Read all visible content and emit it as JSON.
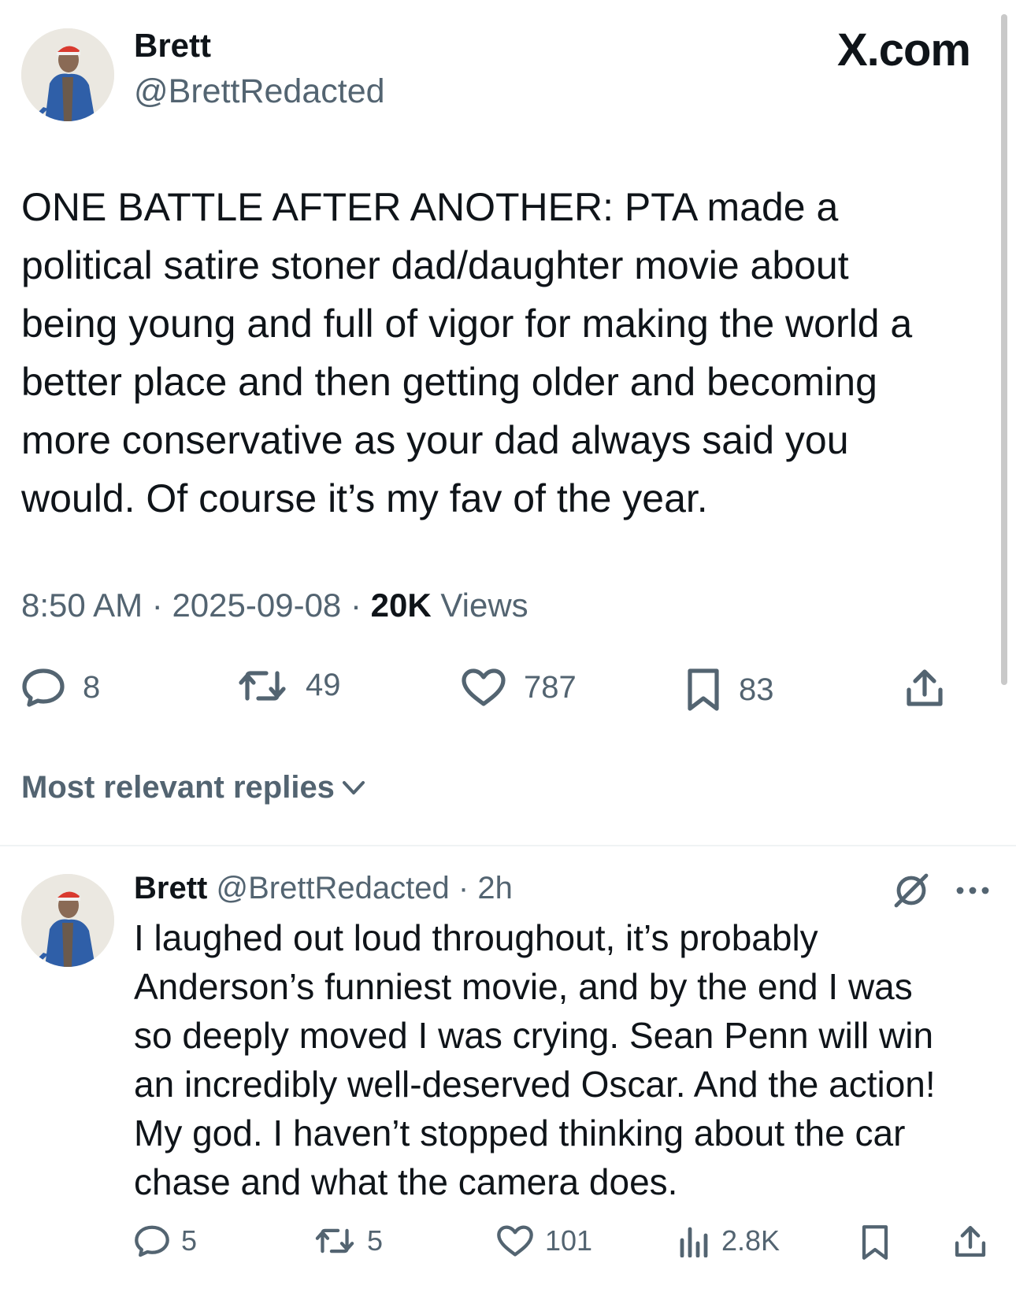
{
  "brand": {
    "label": "X.com"
  },
  "tweet": {
    "author": {
      "name": "Brett",
      "handle": "@BrettRedacted"
    },
    "text_lines": [
      "ONE BATTLE AFTER ANOTHER: PTA made a",
      "political satire stoner dad/daughter movie about",
      "being young and full of vigor for making the world a",
      "better place and then getting older and becoming",
      "more conservative as your dad always said you",
      "would. Of course it’s my fav of the year."
    ],
    "time": "8:50 AM",
    "date": "2025-09-08",
    "separator": "·",
    "views_count": "20K",
    "views_label": "Views",
    "stats": {
      "replies": "8",
      "reposts": "49",
      "likes": "787",
      "bookmarks": "83"
    }
  },
  "sort": {
    "label": "Most relevant replies"
  },
  "reply": {
    "author": {
      "name": "Brett",
      "handle": "@BrettRedacted"
    },
    "age": "2h",
    "text_lines": [
      "I laughed out loud throughout, it’s probably",
      "Anderson’s funniest movie, and by the end I was",
      "so deeply moved I was crying. Sean Penn will win",
      "an incredibly well-deserved Oscar.  And the action!",
      "My god. I haven’t stopped thinking about the car",
      "chase and what the camera does."
    ],
    "stats": {
      "replies": "5",
      "reposts": "5",
      "likes": "101",
      "views": "2.8K"
    }
  },
  "colors": {
    "text": "#0f1419",
    "secondary": "#536471",
    "divider": "#eff3f4"
  },
  "icons": [
    "reply-icon",
    "repost-icon",
    "like-icon",
    "bookmark-icon",
    "share-icon",
    "views-icon",
    "grok-icon",
    "more-icon",
    "chevron-down-icon"
  ]
}
